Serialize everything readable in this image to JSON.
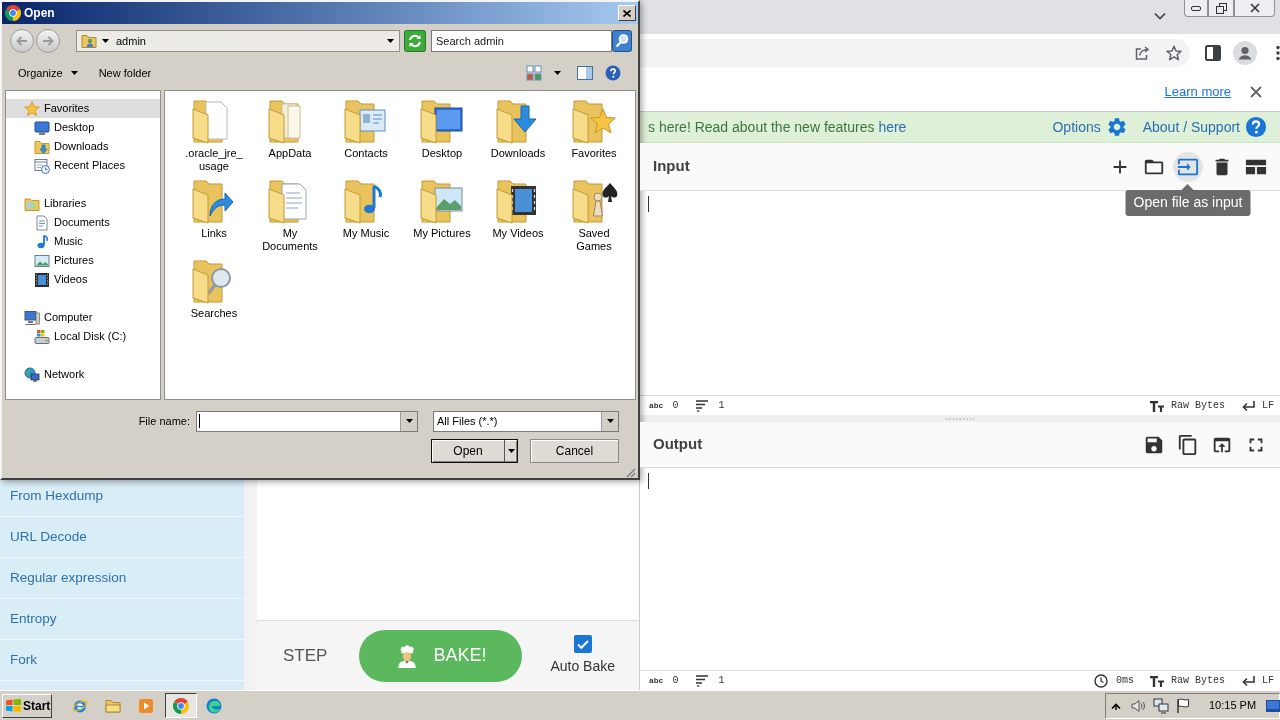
{
  "dialog": {
    "title": "Open",
    "location": "admin",
    "search_placeholder": "Search admin",
    "commands": [
      {
        "label": "Organize",
        "dropdown": true
      },
      {
        "label": "New folder",
        "dropdown": false
      }
    ],
    "nav": [
      {
        "label": "Favorites",
        "kind": "favorites",
        "selected": true,
        "children": [
          {
            "label": "Desktop",
            "kind": "desktop",
            "selected": false
          },
          {
            "label": "Downloads",
            "kind": "downloads",
            "selected": false
          },
          {
            "label": "Recent Places",
            "kind": "recent",
            "selected": false
          }
        ]
      },
      {
        "label": "Libraries",
        "kind": "libraries",
        "selected": false,
        "children": [
          {
            "label": "Documents",
            "kind": "documents",
            "selected": false
          },
          {
            "label": "Music",
            "kind": "music",
            "selected": false
          },
          {
            "label": "Pictures",
            "kind": "pictures",
            "selected": false
          },
          {
            "label": "Videos",
            "kind": "videos",
            "selected": false
          }
        ]
      },
      {
        "label": "Computer",
        "kind": "computer",
        "selected": false,
        "children": [
          {
            "label": "Local Disk (C:)",
            "kind": "disk",
            "selected": false
          }
        ]
      },
      {
        "label": "Network",
        "kind": "network",
        "selected": false
      }
    ],
    "items": [
      {
        "label": ".oracle_jre_usage",
        "kind": "document"
      },
      {
        "label": "AppData",
        "kind": "plain"
      },
      {
        "label": "Contacts",
        "kind": "contacts"
      },
      {
        "label": "Desktop",
        "kind": "desktop"
      },
      {
        "label": "Downloads",
        "kind": "downloads"
      },
      {
        "label": "Favorites",
        "kind": "favorites"
      },
      {
        "label": "Links",
        "kind": "links"
      },
      {
        "label": "My Documents",
        "kind": "documents"
      },
      {
        "label": "My Music",
        "kind": "music"
      },
      {
        "label": "My Pictures",
        "kind": "pictures"
      },
      {
        "label": "My Videos",
        "kind": "videos"
      },
      {
        "label": "Saved Games",
        "kind": "games"
      },
      {
        "label": "Searches",
        "kind": "searches"
      }
    ],
    "file_name": {
      "label": "File name:",
      "focused": true
    },
    "file_type": "All Files (*.*)",
    "buttons": [
      {
        "label": "Open",
        "kind": "split",
        "default": true
      },
      {
        "label": "Cancel",
        "kind": "plain",
        "default": false
      }
    ]
  },
  "browser": {
    "infobar": {
      "link": "Learn more"
    }
  },
  "cyberchef": {
    "banner": {
      "text": "s here! Read about the new features ",
      "link": "here"
    },
    "links": [
      {
        "label": "Options",
        "kind": "options"
      },
      {
        "label": "About / Support",
        "kind": "help"
      }
    ],
    "operations": [
      "From Hexdump",
      "URL Decode",
      "Regular expression",
      "Entropy",
      "Fork"
    ],
    "step": "STEP",
    "bake": "BAKE!",
    "auto_bake": {
      "label": "Auto Bake",
      "checked": true
    },
    "input": {
      "title": "Input",
      "tools": [
        {
          "kind": "add",
          "highlighted": false
        },
        {
          "kind": "folder",
          "highlighted": false
        },
        {
          "kind": "file",
          "highlighted": true,
          "tooltip": "Open file as input"
        },
        {
          "kind": "trash",
          "highlighted": false
        },
        {
          "kind": "layout",
          "highlighted": false
        }
      ],
      "cursor": true,
      "status": {
        "length_mark": "abc",
        "length": "0",
        "lines": "1",
        "encoding": "Raw Bytes",
        "eol": "LF"
      }
    },
    "output": {
      "title": "Output",
      "tools": [
        {
          "kind": "save",
          "highlighted": false
        },
        {
          "kind": "copy",
          "highlighted": false
        },
        {
          "kind": "upload",
          "highlighted": false
        },
        {
          "kind": "fullscreen",
          "highlighted": false
        }
      ],
      "cursor": true,
      "status": {
        "length_mark": "abc",
        "length": "0",
        "lines": "1",
        "time": "0ms",
        "encoding": "Raw Bytes",
        "eol": "LF"
      }
    }
  },
  "taskbar": {
    "start": "Start",
    "apps": [
      {
        "kind": "ie",
        "active": false
      },
      {
        "kind": "explorer",
        "active": false
      },
      {
        "kind": "media",
        "active": false
      },
      {
        "kind": "chrome",
        "active": true
      },
      {
        "kind": "edge",
        "active": false
      }
    ],
    "clock": "10:15 PM"
  }
}
